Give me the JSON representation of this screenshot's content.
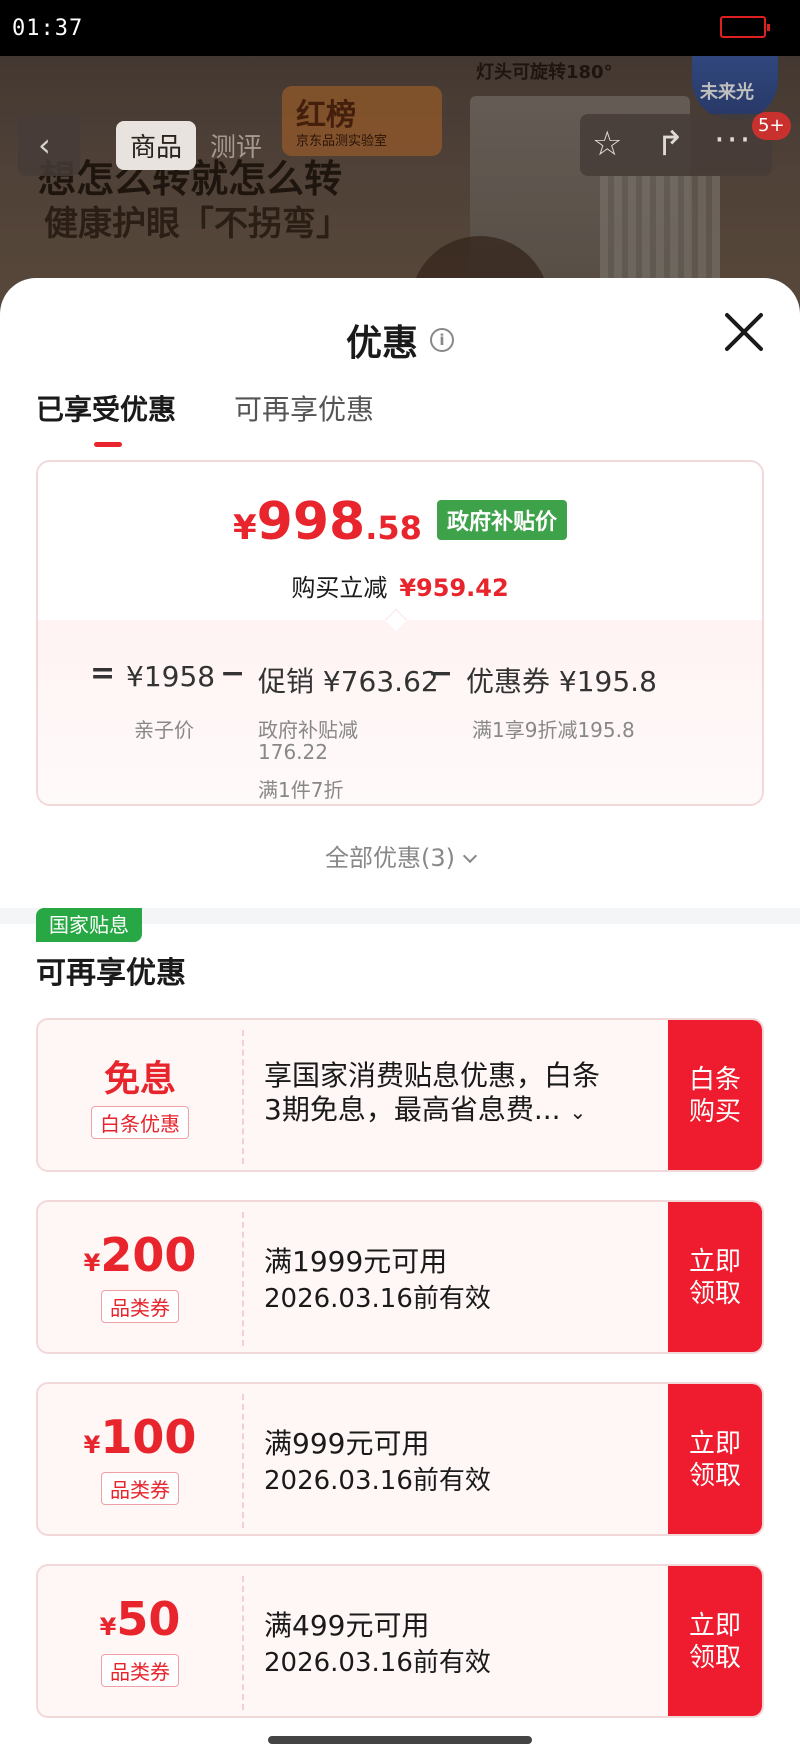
{
  "status_bar": {
    "time": "01:37"
  },
  "hero": {
    "headline": "想怎么转就怎么转",
    "subline": "健康护眼「不拐弯」",
    "badge": "红榜",
    "badge_sub": "京东品测实验室",
    "lamp_text": "灯头可旋转180°",
    "logo_text": "未来光"
  },
  "nav": {
    "tabs": [
      "商品",
      "测评"
    ],
    "badge": "5+"
  },
  "sheet": {
    "title": "优惠",
    "tabs": [
      "已享受优惠",
      "可再享优惠"
    ]
  },
  "summary": {
    "yen": "¥",
    "price_int": "998",
    "price_dec": ".58",
    "gov_tag": "政府补贴价",
    "reduce_label": "购买立减",
    "reduce_amount": "¥959.42",
    "eq": "=",
    "minus": "−",
    "base_price": "¥1958",
    "base_label": "亲子价",
    "promo_label": "促销",
    "promo_amount": "¥763.62",
    "promo_note1": "政府补贴减",
    "promo_note2": "176.22",
    "promo_note3": "满1件7折",
    "coupon_label": "优惠券",
    "coupon_amount": "¥195.8",
    "coupon_note": "满1享9折减195.8"
  },
  "all_deals": "全部优惠(3)",
  "more_section": {
    "title": "可再享优惠",
    "offers": [
      {
        "corner": "国家贴息",
        "big": "免息",
        "tag": "白条优惠",
        "line1": "享国家消费贴息优惠，白条",
        "line2": "3期免息，最高省息费...",
        "btn1": "白条",
        "btn2": "购买"
      },
      {
        "yen": "¥",
        "amount": "200",
        "tag": "品类券",
        "line1": "满1999元可用",
        "line2": "2026.03.16前有效",
        "btn1": "立即",
        "btn2": "领取"
      },
      {
        "yen": "¥",
        "amount": "100",
        "tag": "品类券",
        "line1": "满999元可用",
        "line2": "2026.03.16前有效",
        "btn1": "立即",
        "btn2": "领取"
      },
      {
        "yen": "¥",
        "amount": "50",
        "tag": "品类券",
        "line1": "满499元可用",
        "line2": "2026.03.16前有效",
        "btn1": "立即",
        "btn2": "领取"
      }
    ]
  },
  "colors": {
    "accent_red": "#e8242c",
    "button_red": "#ee1c2e",
    "gov_green": "#3ea24a"
  }
}
